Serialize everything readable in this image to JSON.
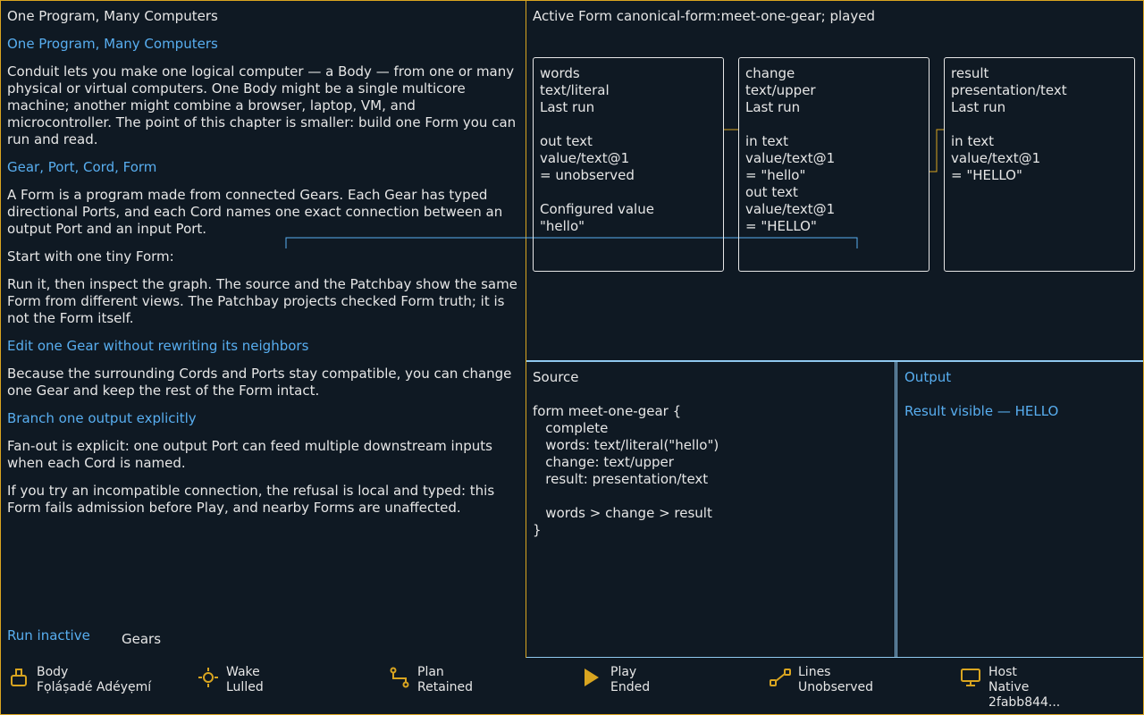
{
  "doc": {
    "title": "One Program, Many Computers",
    "heading1": "One Program, Many Computers",
    "para1": "Conduit lets you make one logical computer — a Body — from one or many physical or virtual computers. One Body might be a single multicore machine; another might combine a browser, laptop, VM, and microcontroller. The point of this chapter is smaller: build one Form you can run and read.",
    "heading2": "Gear, Port, Cord, Form",
    "para2": "A Form is a program made from connected Gears. Each Gear has typed directional Ports, and each Cord names one exact connection between an output Port and an input Port.",
    "para3": "Start with one tiny Form:",
    "para4": "Run it, then inspect the graph. The source and the Patchbay show the same Form from different views. The Patchbay projects checked Form truth; it is not the Form itself.",
    "heading3": "Edit one Gear without rewriting its neighbors",
    "para5": "Because the surrounding Cords and Ports stay compatible, you can change one Gear and keep the rest of the Form intact.",
    "heading4": "Branch one output explicitly",
    "para6": "Fan-out is explicit: one output Port can feed multiple downstream inputs when each Cord is named.",
    "para7": "If you try an incompatible connection, the refusal is local and typed: this Form fails admission before Play, and nearby Forms are unaffected.",
    "run_label": "Run inactive",
    "gears_label": "Gears"
  },
  "active_form": {
    "title": "Active Form canonical-form:meet-one-gear; played",
    "cards": [
      {
        "name": "words",
        "type": "text/literal",
        "status": "Last run",
        "lines": [
          "out text",
          "value/text@1",
          "= unobserved",
          "",
          "Configured value",
          "\"hello\""
        ]
      },
      {
        "name": "change",
        "type": "text/upper",
        "status": "Last run",
        "lines": [
          "in text",
          "value/text@1",
          "= \"hello\"",
          "out text",
          "value/text@1",
          "= \"HELLO\""
        ]
      },
      {
        "name": "result",
        "type": "presentation/text",
        "status": "Last run",
        "lines": [
          "in text",
          "value/text@1",
          "= \"HELLO\""
        ]
      }
    ]
  },
  "source": {
    "title": "Source",
    "code": "form meet-one-gear {\n   complete\n   words: text/literal(\"hello\")\n   change: text/upper\n   result: presentation/text\n\n   words > change > result\n}"
  },
  "output": {
    "title": "Output",
    "result": "Result visible — HELLO"
  },
  "status": {
    "body": {
      "label": "Body",
      "value": "Fọláṣadé Adéyẹmí",
      "icon": "body-icon"
    },
    "wake": {
      "label": "Wake",
      "value": "Lulled",
      "icon": "sun-icon"
    },
    "plan": {
      "label": "Plan",
      "value": "Retained",
      "icon": "plan-icon"
    },
    "play": {
      "label": "Play",
      "value": "Ended",
      "icon": "play-icon"
    },
    "lines": {
      "label": "Lines",
      "value": "Unobserved",
      "icon": "lines-icon"
    },
    "host": {
      "label": "Host",
      "value": "Native",
      "value2": "2fabb844...",
      "icon": "monitor-icon"
    }
  },
  "colors": {
    "background": "#0f1923",
    "accent_gold": "#d9a520",
    "link_blue": "#58aef0",
    "panel_border": "#8fc8ef",
    "text": "#e6e6e6"
  }
}
